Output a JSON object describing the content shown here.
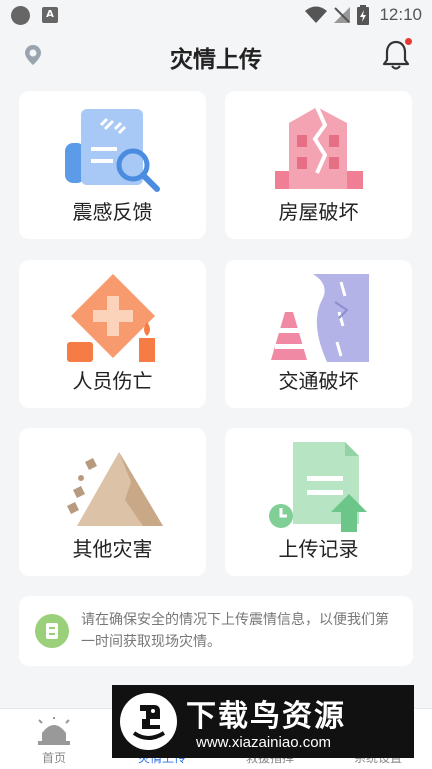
{
  "status": {
    "time": "12:10",
    "a_badge": "A"
  },
  "header": {
    "title": "灾情上传"
  },
  "cards": [
    {
      "label": "震感反馈"
    },
    {
      "label": "房屋破坏"
    },
    {
      "label": "人员伤亡"
    },
    {
      "label": "交通破坏"
    },
    {
      "label": "其他灾害"
    },
    {
      "label": "上传记录"
    }
  ],
  "notice": {
    "text": "请在确保安全的情况下上传震情信息，以便我们第一时间获取现场灾情。"
  },
  "tabs": [
    {
      "label": "首页"
    },
    {
      "label": "灾情上传",
      "active": true
    },
    {
      "label": "救援指挥"
    },
    {
      "label": "系统设置"
    }
  ],
  "watermark": {
    "title": "下载鸟资源",
    "url": "www.xiazainiao.com"
  },
  "colors": {
    "accent": "#2f6fe4",
    "background": "#f4f5f7",
    "notification_dot": "#e53935"
  }
}
